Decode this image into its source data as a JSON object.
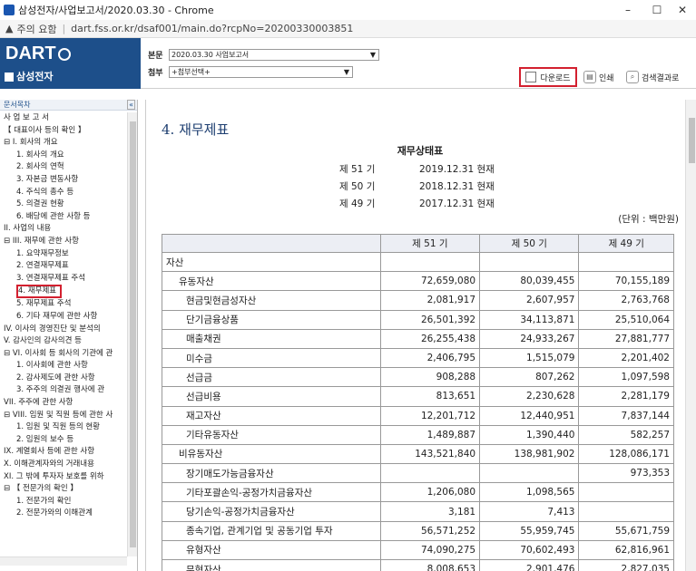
{
  "window": {
    "title": "삼성전자/사업보고서/2020.03.30 - Chrome",
    "min": "–",
    "max": "☐",
    "close": "✕"
  },
  "address": {
    "security": "주의 요함",
    "url": "dart.fss.or.kr/dsaf001/main.do?rcpNo=20200330003851"
  },
  "header": {
    "logo": "DART",
    "company": "삼성전자",
    "report_label": "본문",
    "report_value": "2020.03.30  사업보고서",
    "attach_label": "첨부",
    "attach_value": "+첨부선택+",
    "download": "다운로드",
    "print": "인쇄",
    "search_results": "검색결과로"
  },
  "sidebar": {
    "title": "문서목차",
    "collapse": "«",
    "items": [
      "사 업 보 고 서",
      "【 대표이사 등의 확인 】",
      "⊟ I. 회사의 개요",
      "1. 회사의 개요",
      "2. 회사의 연혁",
      "3. 자본금 변동사항",
      "4. 주식의 총수 등",
      "5. 의결권 현황",
      "6. 배당에 관한 사항 등",
      "II. 사업의 내용",
      "⊟ III. 재무에 관한 사항",
      "1. 요약재무정보",
      "2. 연결재무제표",
      "3. 연결재무제표 주석",
      "4. 재무제표",
      "5. 재무제표 주석",
      "6. 기타 재무에 관한 사항",
      "IV. 이사의 경영진단 및 분석의",
      "V. 감사인의 감사의견 등",
      "⊟ VI. 이사회 등 회사의 기관에 관",
      "1. 이사회에 관한 사항",
      "2. 감사제도에 관한 사항",
      "3. 주주의 의결권 행사에 관",
      "VII. 주주에 관한 사항",
      "⊟ VIII. 임원 및 직원 등에 관한 사",
      "1. 임원 및 직원 등의 현황",
      "2. 임원의 보수 등",
      "IX. 계열회사 등에 관한 사항",
      "X. 이해관계자와의 거래내용",
      "XI. 그 밖에 투자자 보호를 위하",
      "⊟ 【 전문가의 확인 】",
      "1. 전문가의 확인",
      "2. 전문가와의 이해관계"
    ],
    "indent": [
      0,
      0,
      0,
      1,
      1,
      1,
      1,
      1,
      1,
      0,
      0,
      1,
      1,
      1,
      1,
      1,
      1,
      0,
      0,
      0,
      1,
      1,
      1,
      0,
      0,
      1,
      1,
      0,
      0,
      0,
      0,
      1,
      1
    ],
    "selected_index": 14
  },
  "document": {
    "heading": "4. 재무제표",
    "statement_title": "재무상태표",
    "periods": [
      {
        "term": "제 51 기",
        "date": "2019.12.31 현재"
      },
      {
        "term": "제 50 기",
        "date": "2018.12.31 현재"
      },
      {
        "term": "제 49 기",
        "date": "2017.12.31 현재"
      }
    ],
    "unit": "(단위 : 백만원)",
    "columns": [
      "",
      "제 51 기",
      "제 50 기",
      "제 49 기"
    ],
    "rows": [
      {
        "label": "자산",
        "level": 0,
        "v": [
          "",
          "",
          ""
        ]
      },
      {
        "label": "유동자산",
        "level": 1,
        "v": [
          "72,659,080",
          "80,039,455",
          "70,155,189"
        ]
      },
      {
        "label": "현금및현금성자산",
        "level": 2,
        "v": [
          "2,081,917",
          "2,607,957",
          "2,763,768"
        ]
      },
      {
        "label": "단기금융상품",
        "level": 2,
        "v": [
          "26,501,392",
          "34,113,871",
          "25,510,064"
        ]
      },
      {
        "label": "매출채권",
        "level": 2,
        "v": [
          "26,255,438",
          "24,933,267",
          "27,881,777"
        ]
      },
      {
        "label": "미수금",
        "level": 2,
        "v": [
          "2,406,795",
          "1,515,079",
          "2,201,402"
        ]
      },
      {
        "label": "선급금",
        "level": 2,
        "v": [
          "908,288",
          "807,262",
          "1,097,598"
        ]
      },
      {
        "label": "선급비용",
        "level": 2,
        "v": [
          "813,651",
          "2,230,628",
          "2,281,179"
        ]
      },
      {
        "label": "재고자산",
        "level": 2,
        "v": [
          "12,201,712",
          "12,440,951",
          "7,837,144"
        ]
      },
      {
        "label": "기타유동자산",
        "level": 2,
        "v": [
          "1,489,887",
          "1,390,440",
          "582,257"
        ]
      },
      {
        "label": "비유동자산",
        "level": 1,
        "v": [
          "143,521,840",
          "138,981,902",
          "128,086,171"
        ]
      },
      {
        "label": "장기매도가능금융자산",
        "level": 2,
        "v": [
          "",
          "",
          "973,353"
        ]
      },
      {
        "label": "기타포괄손익-공정가치금융자산",
        "level": 2,
        "v": [
          "1,206,080",
          "1,098,565",
          ""
        ]
      },
      {
        "label": "당기손익-공정가치금융자산",
        "level": 2,
        "v": [
          "3,181",
          "7,413",
          ""
        ]
      },
      {
        "label": "종속기업, 관계기업 및 공동기업 투자",
        "level": 2,
        "v": [
          "56,571,252",
          "55,959,745",
          "55,671,759"
        ]
      },
      {
        "label": "유형자산",
        "level": 2,
        "v": [
          "74,090,275",
          "70,602,493",
          "62,816,961"
        ]
      },
      {
        "label": "무형자산",
        "level": 2,
        "v": [
          "8,008,653",
          "2,901,476",
          "2,827,035"
        ]
      }
    ]
  }
}
